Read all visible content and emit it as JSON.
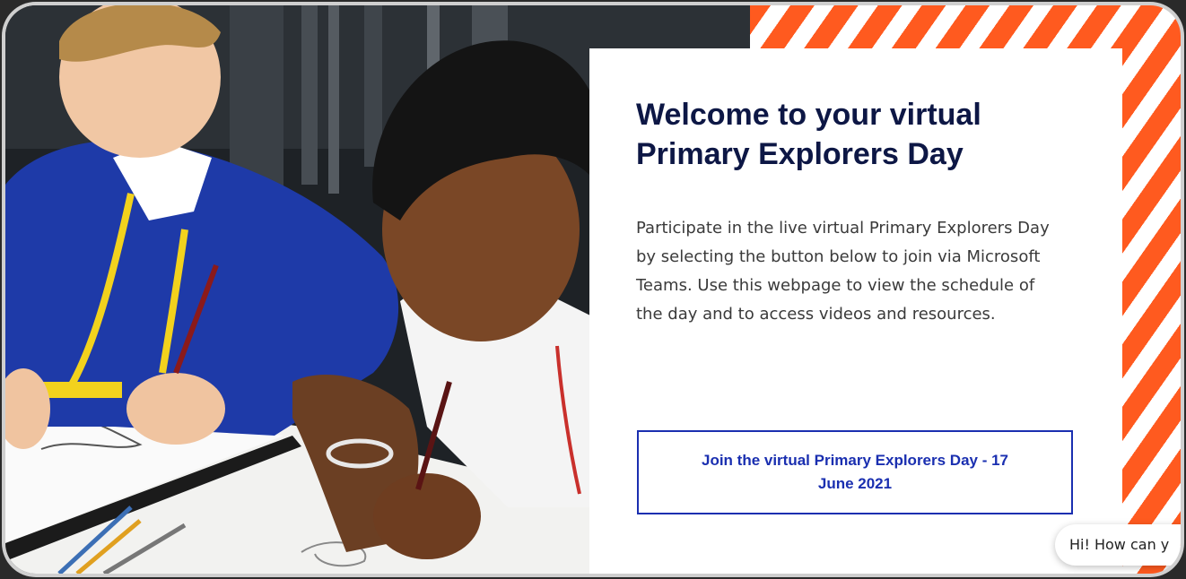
{
  "hero": {
    "title_line1": "Welcome to your virtual",
    "title_line2": "Primary Explorers Day",
    "body": "Participate in the live virtual Primary Explorers Day by selecting the button below to join via Microsoft Teams. Use this webpage to view the schedule of the day and to access videos and resources.",
    "join_button": {
      "line1": "Join the virtual Primary Explorers Day - 17",
      "line2": "June 2021"
    }
  },
  "chat": {
    "greeting": "Hi! How can y"
  },
  "colors": {
    "title": "#0d1745",
    "button_accent": "#1a2fb0",
    "stripe_orange": "#ff5a1f"
  },
  "images": {
    "photo": "students-drawing-photo"
  }
}
